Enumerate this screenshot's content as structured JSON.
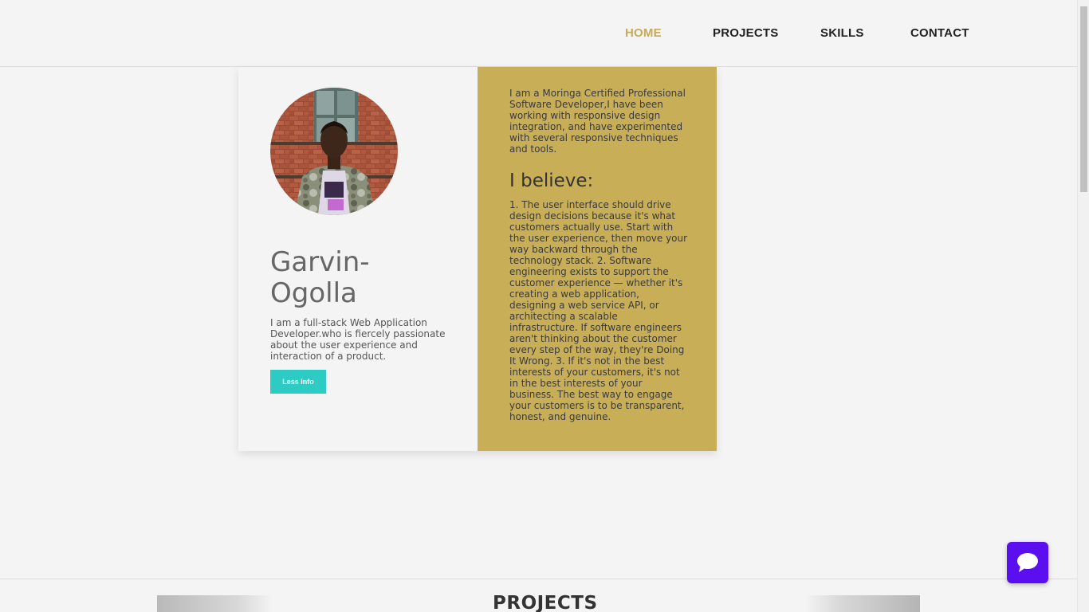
{
  "nav": {
    "items": [
      {
        "label": "HOME",
        "active": true
      },
      {
        "label": "PROJECTS",
        "active": false
      },
      {
        "label": "SKILLS",
        "active": false
      },
      {
        "label": "CONTACT",
        "active": false
      }
    ]
  },
  "profile": {
    "name": "Garvin-Ogolla",
    "name_line1": "Garvin-",
    "name_line2": "Ogolla",
    "bio": "I am a full-stack Web Application Developer.who is fiercely passionate about the user experience and interaction of a product.",
    "button_label": "Less Info"
  },
  "about": {
    "intro": "I am a Moringa Certified Professional Software Developer,I have been working with responsive design integration, and have experimented with several responsive techniques and tools.",
    "believe_heading": "I believe:",
    "believe_text": "1. The user interface should drive design decisions because it's what customers actually use. Start with the user experience, then move your way backward through the technology stack. 2. Software engineering exists to support the customer experience — whether it's creating a web application, designing a web service API, or architecting a scalable infrastructure. If software engineers aren't thinking about the customer every step of the way, they're Doing It Wrong. 3. If it's not in the best interests of your customers, it's not in the best interests of your business. The best way to engage your customers is to be transparent, honest, and genuine."
  },
  "projects": {
    "title": "PROJECTS"
  },
  "colors": {
    "accent_gold": "#c9ae58",
    "button_teal": "#2dcbc3",
    "chat_purple": "#5b0ff0"
  },
  "icons": {
    "chat": "chat-bubble-icon"
  }
}
